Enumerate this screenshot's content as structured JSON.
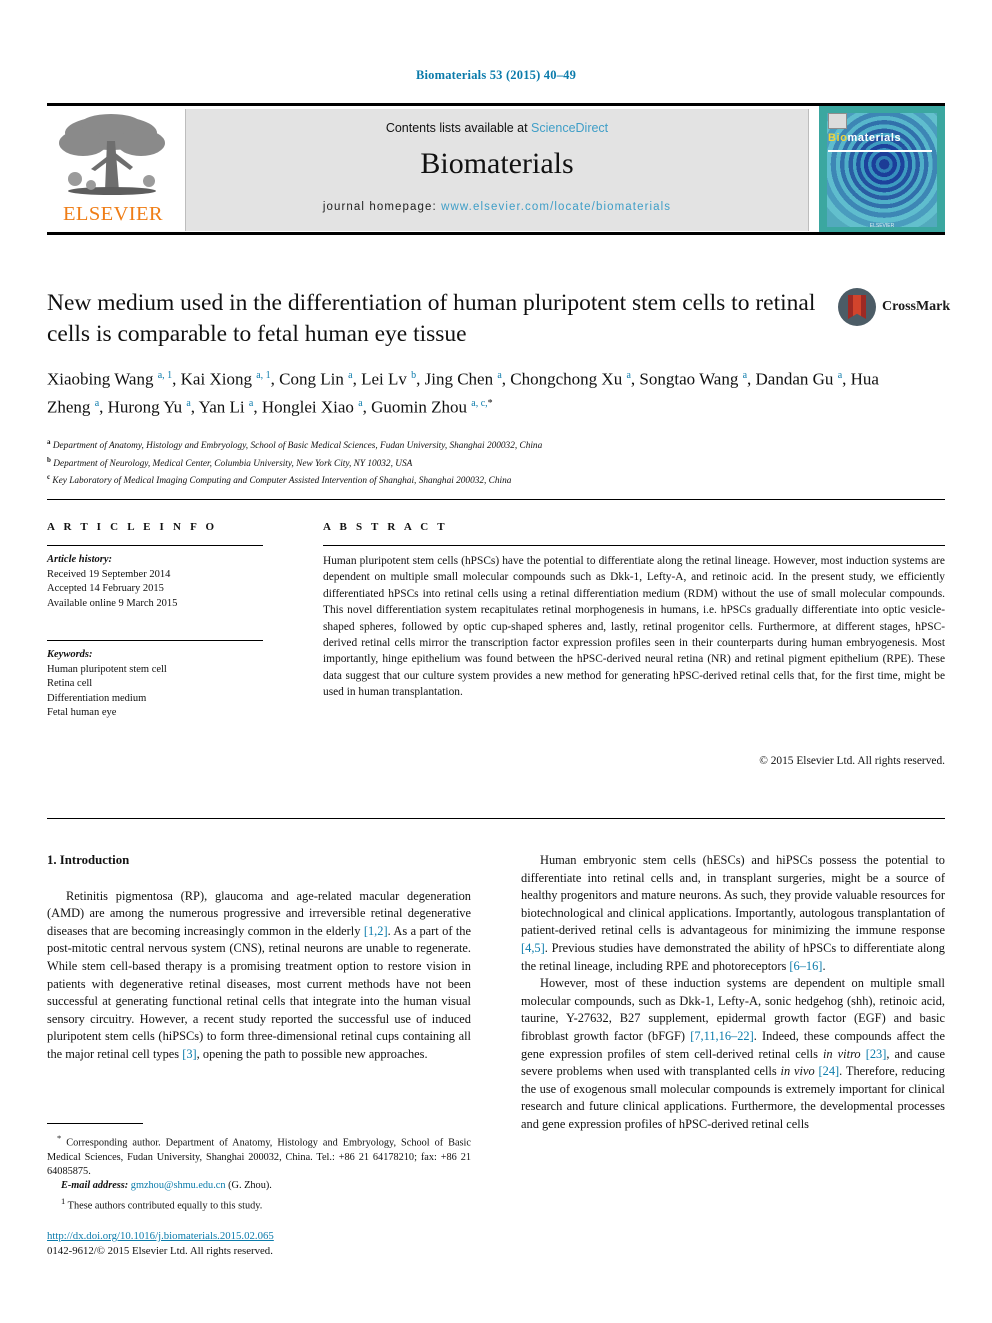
{
  "running_head": "Biomaterials 53 (2015) 40–49",
  "masthead": {
    "publisher_logo_label": "ELSEVIER",
    "contents_prefix": "Contents lists available at ",
    "contents_link": "ScienceDirect",
    "journal_name": "Biomaterials",
    "homepage_prefix": "journal homepage: ",
    "homepage_url": "www.elsevier.com/locate/biomaterials",
    "cover": {
      "title_part1": "Bio",
      "title_part2": "materials",
      "footer": "ELSEVIER"
    }
  },
  "article": {
    "title": "New medium used in the differentiation of human pluripotent stem cells to retinal cells is comparable to fetal human eye tissue",
    "crossmark_label": "CrossMark",
    "authors_html": "Xiaobing Wang <sup>a, 1</sup>, Kai Xiong <sup>a, 1</sup>, Cong Lin <sup>a</sup>, Lei Lv <sup>b</sup>, Jing Chen <sup>a</sup>, Chongchong Xu <sup>a</sup>, Songtao Wang <sup>a</sup>, Dandan Gu <sup>a</sup>, Hua Zheng <sup>a</sup>, Hurong Yu <sup>a</sup>, Yan Li <sup>a</sup>, Honglei Xiao <sup>a</sup>, Guomin Zhou <sup>a, c,</sup><sup class=\"star\">*</sup>",
    "affiliations_html": "<sup>a</sup> Department of Anatomy, Histology and Embryology, School of Basic Medical Sciences, Fudan University, Shanghai 200032, China<br><sup>b</sup> Department of Neurology, Medical Center, Columbia University, New York City, NY 10032, USA<br><sup>c</sup> Key Laboratory of Medical Imaging Computing and Computer Assisted Intervention of Shanghai, Shanghai 200032, China"
  },
  "article_info": {
    "heading": "A R T I C L E  I N F O",
    "history_label": "Article history:",
    "history": [
      "Received 19 September 2014",
      "Accepted 14 February 2015",
      "Available online 9 March 2015"
    ],
    "keywords_label": "Keywords:",
    "keywords": [
      "Human pluripotent stem cell",
      "Retina cell",
      "Differentiation medium",
      "Fetal human eye"
    ]
  },
  "abstract": {
    "heading": "A B S T R A C T",
    "text": "Human pluripotent stem cells (hPSCs) have the potential to differentiate along the retinal lineage. However, most induction systems are dependent on multiple small molecular compounds such as Dkk-1, Lefty-A, and retinoic acid. In the present study, we efficiently differentiated hPSCs into retinal cells using a retinal differentiation medium (RDM) without the use of small molecular compounds. This novel differentiation system recapitulates retinal morphogenesis in humans, i.e. hPSCs gradually differentiate into optic vesicle-shaped spheres, followed by optic cup-shaped spheres and, lastly, retinal progenitor cells. Furthermore, at different stages, hPSC-derived retinal cells mirror the transcription factor expression profiles seen in their counterparts during human embryogenesis. Most importantly, hinge epithelium was found between the hPSC-derived neural retina (NR) and retinal pigment epithelium (RPE). These data suggest that our culture system provides a new method for generating hPSC-derived retinal cells that, for the first time, might be used in human transplantation.",
    "copyright": "© 2015 Elsevier Ltd. All rights reserved."
  },
  "body": {
    "section_number_title": "1.  Introduction",
    "left_paragraphs_html": [
      "Retinitis pigmentosa (RP), glaucoma and age-related macular degeneration (AMD) are among the numerous progressive and irreversible retinal degenerative diseases that are becoming increasingly common in the elderly <span class=\"ref\">[1,2]</span>. As a part of the post-mitotic central nervous system (CNS), retinal neurons are unable to regenerate. While stem cell-based therapy is a promising treatment option to restore vision in patients with degenerative retinal diseases, most current methods have not been successful at generating functional retinal cells that integrate into the human visual sensory circuitry. However, a recent study reported the successful use of induced pluripotent stem cells (hiPSCs) to form three-dimensional retinal cups containing all the major retinal cell types <span class=\"ref\">[3]</span>, opening the path to possible new approaches."
    ],
    "right_paragraphs_html": [
      "Human embryonic stem cells (hESCs) and hiPSCs possess the potential to differentiate into retinal cells and, in transplant surgeries, might be a source of healthy progenitors and mature neurons. As such, they provide valuable resources for biotechnological and clinical applications. Importantly, autologous transplantation of patient-derived retinal cells is advantageous for minimizing the immune response <span class=\"ref\">[4,5]</span>. Previous studies have demonstrated the ability of hPSCs to differentiate along the retinal lineage, including RPE and photoreceptors <span class=\"ref\">[6–16]</span>.",
      "However, most of these induction systems are dependent on multiple small molecular compounds, such as Dkk-1, Lefty-A, sonic hedgehog (shh), retinoic acid, taurine, Y-27632, B27 supplement, epidermal growth factor (EGF) and basic fibroblast growth factor (bFGF) <span class=\"ref\">[7,11,16–22]</span>. Indeed, these compounds affect the gene expression profiles of stem cell-derived retinal cells <i>in vitro</i> <span class=\"ref\">[23]</span>, and cause severe problems when used with transplanted cells <i>in vivo</i> <span class=\"ref\">[24]</span>. Therefore, reducing the use of exogenous small molecular compounds is extremely important for clinical research and future clinical applications. Furthermore, the developmental processes and gene expression profiles of hPSC-derived retinal cells"
    ]
  },
  "footnotes": {
    "corresponding_html": "<sup>*</sup> Corresponding author. Department of Anatomy, Histology and Embryology, School of Basic Medical Sciences, Fudan University, Shanghai 200032, China. Tel.: +86 21 64178210; fax: +86 21 64085875.",
    "email_label": "E-mail address:",
    "email": "gmzhou@shmu.edu.cn",
    "email_suffix": " (G. Zhou).",
    "equal_contrib_html": "<sup>1</sup>  These authors contributed equally to this study."
  },
  "doi_block": {
    "doi_url": "http://dx.doi.org/10.1016/j.biomaterials.2015.02.065",
    "issn_line": "0142-9612/© 2015 Elsevier Ltd. All rights reserved."
  },
  "colors": {
    "link_blue": "#0b7bab",
    "sciencedirect_blue": "#3f9ec7",
    "elsevier_orange": "#ef7d16"
  }
}
